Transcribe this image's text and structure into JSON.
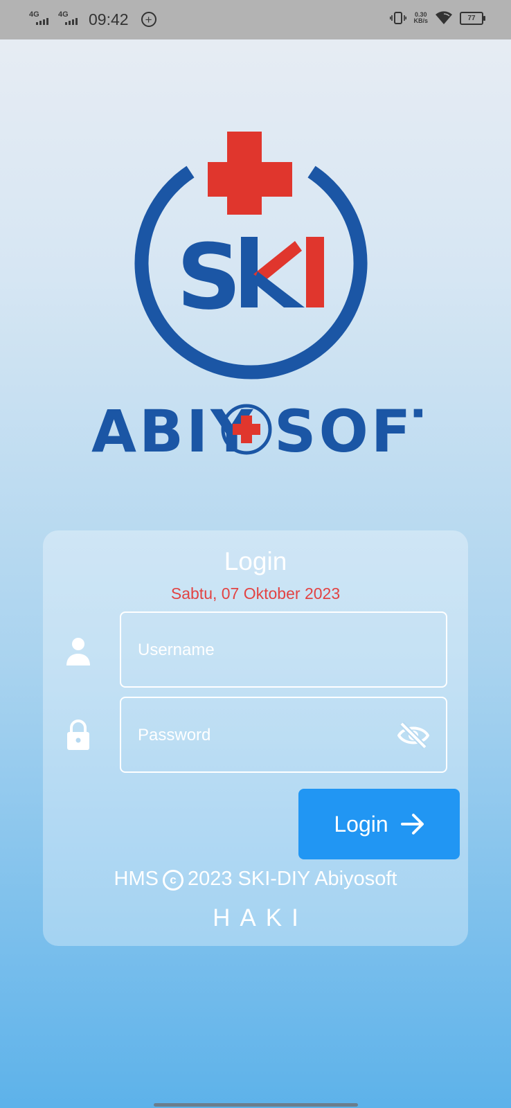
{
  "status_bar": {
    "network1": "4G",
    "network2": "4G",
    "time": "09:42",
    "speed_value": "0.30",
    "speed_unit": "KB/s",
    "battery": "77"
  },
  "logo": {
    "mark_text": "SKI",
    "brand_text": "ABIYOSOFT",
    "colors": {
      "blue": "#1b56a5",
      "red": "#e0362d"
    }
  },
  "login_card": {
    "title": "Login",
    "date": "Sabtu, 07 Oktober 2023",
    "username_placeholder": "Username",
    "password_placeholder": "Password",
    "login_button": "Login",
    "copyright_prefix": "HMS",
    "copyright_rest": "2023 SKI-DIY Abiyosoft",
    "haki": "HAKI"
  },
  "colors": {
    "accent": "#2196f3",
    "date_red": "#e24343"
  }
}
